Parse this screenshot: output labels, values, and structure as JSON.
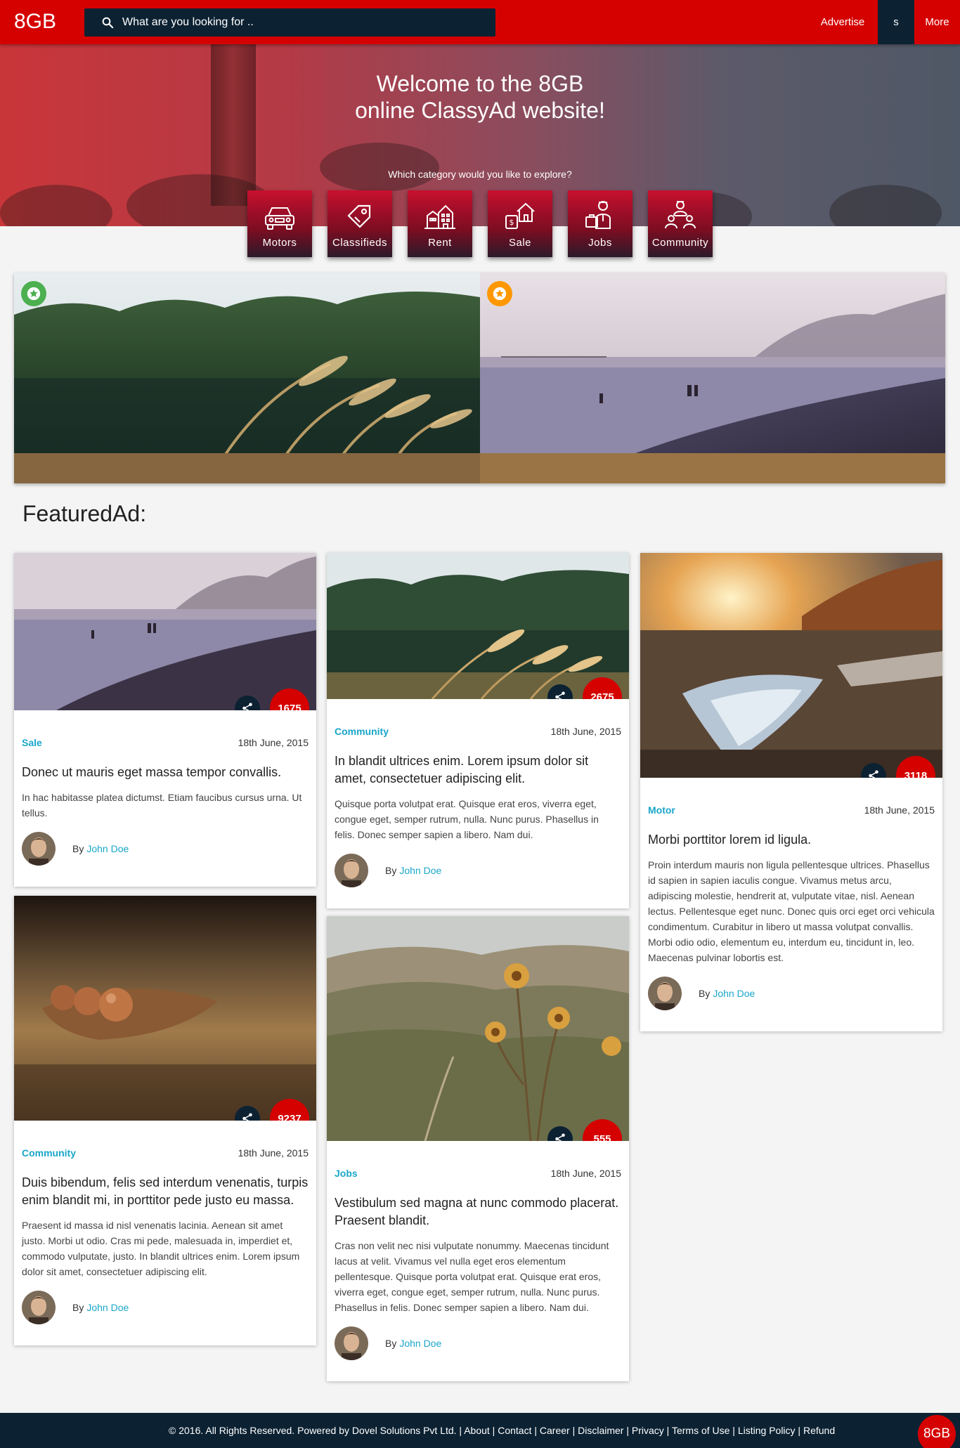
{
  "header": {
    "logo": "8GB",
    "search_placeholder": "What are you looking for ..",
    "nav": {
      "advertise": "Advertise",
      "s": "s",
      "more": "More"
    }
  },
  "hero": {
    "title_line1": "Welcome to the 8GB",
    "title_line2": "online ClassyAd website!",
    "subtitle": "Which category would you like to explore?"
  },
  "categories": [
    {
      "label": "Motors",
      "icon": "car-icon"
    },
    {
      "label": "Classifieds",
      "icon": "tag-icon"
    },
    {
      "label": "Rent",
      "icon": "buildings-icon"
    },
    {
      "label": "Sale",
      "icon": "house-sale-icon"
    },
    {
      "label": "Jobs",
      "icon": "briefcase-person-icon"
    },
    {
      "label": "Community",
      "icon": "people-icon"
    }
  ],
  "slider": {
    "slides": [
      {
        "image": "wheat-field-image",
        "badge_color": "#4caf50"
      },
      {
        "image": "beach-image",
        "badge_color": "#ff9800"
      }
    ]
  },
  "featured": {
    "title": "FeaturedAd:",
    "by_label": "By",
    "cards": [
      {
        "category": "Sale",
        "date": "18th June, 2015",
        "count": "1675",
        "title": "Donec ut mauris eget massa tempor convallis.",
        "desc": "In hac habitasse platea dictumst. Etiam faucibus cursus urna. Ut tellus.",
        "author": "John Doe",
        "image": "beach-image"
      },
      {
        "category": "Community",
        "date": "18th June, 2015",
        "count": "2675",
        "title": "In blandit ultrices enim. Lorem ipsum dolor sit amet, consectetuer adipiscing elit.",
        "desc": "Quisque porta volutpat erat. Quisque erat eros, viverra eget, congue eget, semper rutrum, nulla. Nunc purus. Phasellus in felis. Donec semper sapien a libero. Nam dui.",
        "author": "John Doe",
        "image": "wheat-field-image"
      },
      {
        "category": "Motor",
        "date": "18th June, 2015",
        "count": "3118",
        "title": "Morbi porttitor lorem id ligula.",
        "desc": "Proin interdum mauris non ligula pellentesque ultrices. Phasellus id sapien in sapien iaculis congue. Vivamus metus arcu, adipiscing molestie, hendrerit at, vulputate vitae, nisl. Aenean lectus. Pellentesque eget nunc. Donec quis orci eget orci vehicula condimentum. Curabitur in libero ut massa volutpat convallis. Morbi odio odio, elementum eu, interdum eu, tincidunt in, leo. Maecenas pulvinar lobortis est.",
        "author": "John Doe",
        "image": "sunset-road-image"
      },
      {
        "category": "Community",
        "date": "18th June, 2015",
        "count": "9237",
        "title": "Duis bibendum, felis sed interdum venenatis, turpis enim blandit mi, in porttitor pede justo eu massa.",
        "desc": "Praesent id massa id nisl venenatis lacinia. Aenean sit amet justo. Morbi ut odio. Cras mi pede, malesuada in, imperdiet et, commodo vulputate, justo. In blandit ultrices enim. Lorem ipsum dolor sit amet, consectetuer adipiscing elit.",
        "author": "John Doe",
        "image": "seeds-image"
      },
      {
        "category": "Jobs",
        "date": "18th June, 2015",
        "count": "555",
        "title": "Vestibulum sed magna at nunc commodo placerat. Praesent blandit.",
        "desc": "Cras non velit nec nisi vulputate nonummy. Maecenas tincidunt lacus at velit. Vivamus vel nulla eget eros elementum pellentesque. Quisque porta volutpat erat. Quisque erat eros, viverra eget, congue eget, semper rutrum, nulla. Nunc purus. Phasellus in felis. Donec semper sapien a libero. Nam dui.",
        "author": "John Doe",
        "image": "thistle-valley-image"
      }
    ]
  },
  "footer": {
    "copyright": "© 2016. All Rights Reserved. Powered by",
    "company": "Dovel Solutions Pvt Ltd.",
    "links": [
      "About",
      "Contact",
      "Career",
      "Disclaimer",
      "Privacy",
      "Terms of Use",
      "Listing Policy",
      "Refund"
    ],
    "badge": "8GB"
  },
  "colors": {
    "brand_red": "#d50000",
    "navy": "#0c2233",
    "link_blue": "#1aa6c9"
  }
}
